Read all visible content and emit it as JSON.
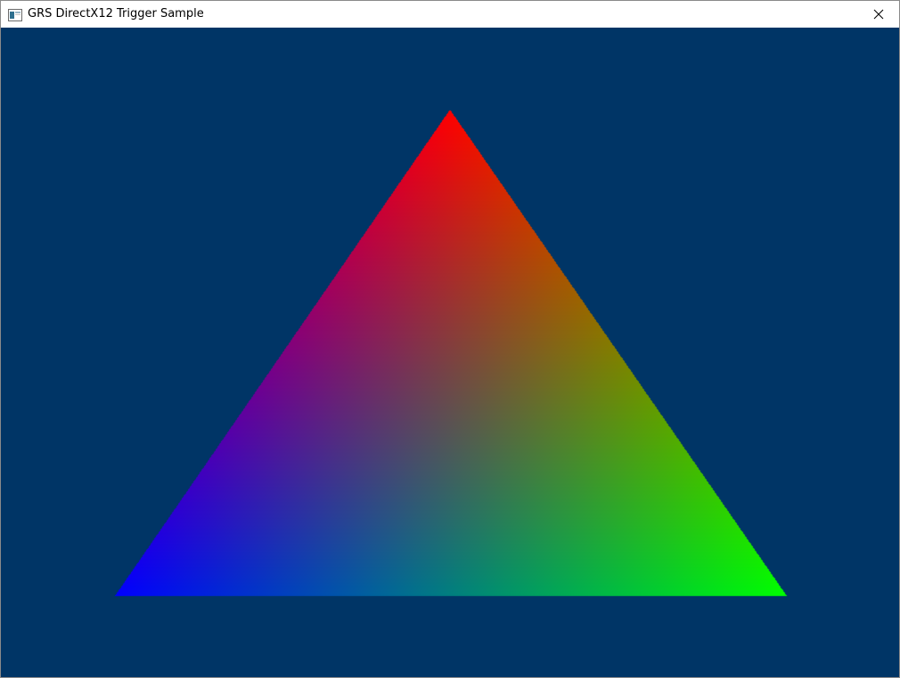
{
  "window": {
    "title": "GRS DirectX12 Trigger Sample",
    "icon": "app-window-icon",
    "close_icon": "close-icon"
  },
  "viewport": {
    "clear_color": "#003566",
    "triangle": {
      "vertex_colors": {
        "top": "#ff0000",
        "bottom_right": "#00ff00",
        "bottom_left": "#0000ff"
      }
    }
  }
}
